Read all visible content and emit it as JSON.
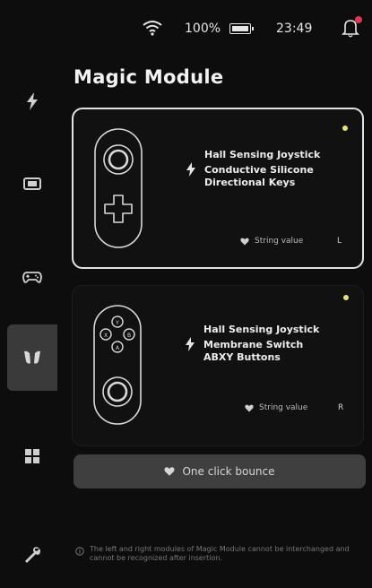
{
  "status_bar": {
    "battery_text": "100%",
    "time": "23:49",
    "icons": [
      "wifi-icon",
      "battery-icon",
      "bell-icon"
    ],
    "notification_dot_color": "#e0354d"
  },
  "sidebar": {
    "items": [
      {
        "icon": "lightning-icon",
        "active": false
      },
      {
        "icon": "handheld-screen-icon",
        "active": false
      },
      {
        "icon": "gamepad-icon",
        "active": false
      },
      {
        "icon": "magic-module-icon",
        "active": true
      },
      {
        "icon": "grid-icon",
        "active": false
      },
      {
        "icon": "wrench-icon",
        "active": false
      }
    ]
  },
  "page": {
    "title": "Magic Module"
  },
  "modules": [
    {
      "selected": true,
      "line1": "Hall Sensing Joystick",
      "line2": "Conductive Silicone",
      "line3": "Directional Keys",
      "string_label": "String value",
      "string_value": "L",
      "dot_color": "#e8e07a"
    },
    {
      "selected": false,
      "line1": "Hall Sensing Joystick",
      "line2": "Membrane Switch",
      "line3": "ABXY Buttons",
      "string_label": "String value",
      "string_value": "R",
      "dot_color": "#e8e07a"
    }
  ],
  "bounce_button": {
    "label": "One click bounce"
  },
  "footnote": {
    "text": "The left and right modules of Magic Module cannot be interchanged and cannot be recognized after insertion."
  }
}
